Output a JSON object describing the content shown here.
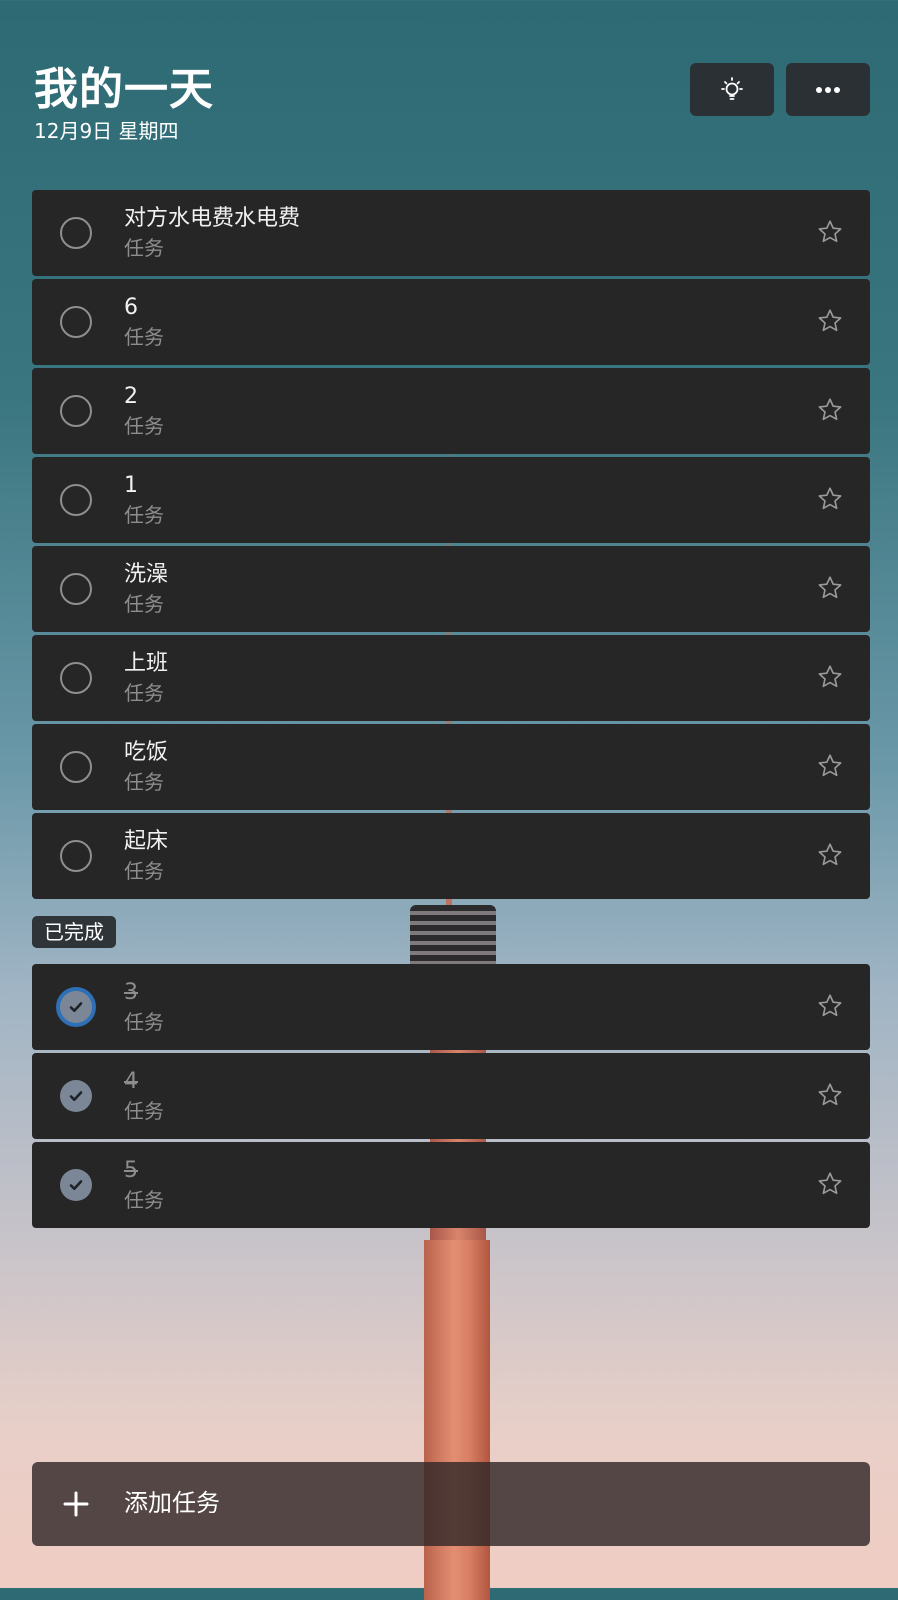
{
  "header": {
    "title": "我的一天",
    "date": "12月9日 星期四",
    "suggestions_icon": "lightbulb-icon",
    "more_icon": "ellipsis-icon"
  },
  "tasks": [
    {
      "name": "对方水电费水电费",
      "list": "任务"
    },
    {
      "name": "6",
      "list": "任务"
    },
    {
      "name": "2",
      "list": "任务"
    },
    {
      "name": "1",
      "list": "任务"
    },
    {
      "name": "洗澡",
      "list": "任务"
    },
    {
      "name": "上班",
      "list": "任务"
    },
    {
      "name": "吃饭",
      "list": "任务"
    },
    {
      "name": "起床",
      "list": "任务"
    }
  ],
  "completed_label": "已完成",
  "completed": [
    {
      "name": "3",
      "list": "任务"
    },
    {
      "name": "4",
      "list": "任务"
    },
    {
      "name": "5",
      "list": "任务"
    }
  ],
  "add_task": {
    "label": "添加任务",
    "icon": "plus-icon"
  },
  "colors": {
    "accent": "#2f6fb6",
    "card": "#262626",
    "check_fill": "#7b8796"
  }
}
